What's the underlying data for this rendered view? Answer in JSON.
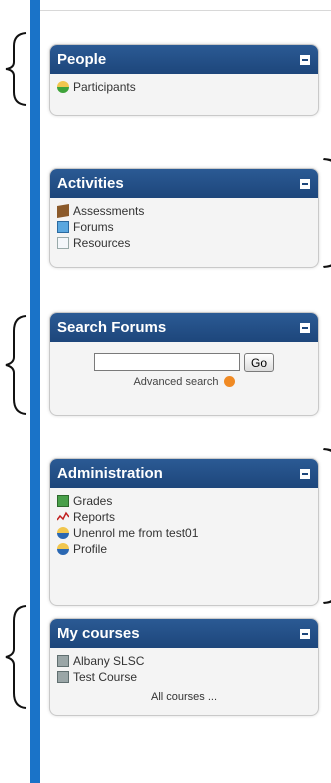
{
  "people": {
    "title": "People",
    "items": [
      {
        "label": "Participants"
      }
    ]
  },
  "activities": {
    "title": "Activities",
    "items": [
      {
        "label": "Assessments"
      },
      {
        "label": "Forums"
      },
      {
        "label": "Resources"
      }
    ]
  },
  "search_forums": {
    "title": "Search Forums",
    "go_label": "Go",
    "advanced_label": "Advanced search",
    "placeholder": ""
  },
  "administration": {
    "title": "Administration",
    "items": [
      {
        "label": "Grades"
      },
      {
        "label": "Reports"
      },
      {
        "label": "Unenrol me from test01"
      },
      {
        "label": "Profile"
      }
    ]
  },
  "my_courses": {
    "title": "My courses",
    "items": [
      {
        "label": "Albany SLSC"
      },
      {
        "label": "Test Course"
      }
    ],
    "all_courses_label": "All courses ..."
  },
  "colors": {
    "accent_bar": "#1a73c8",
    "panel_header": "#1d467b"
  }
}
